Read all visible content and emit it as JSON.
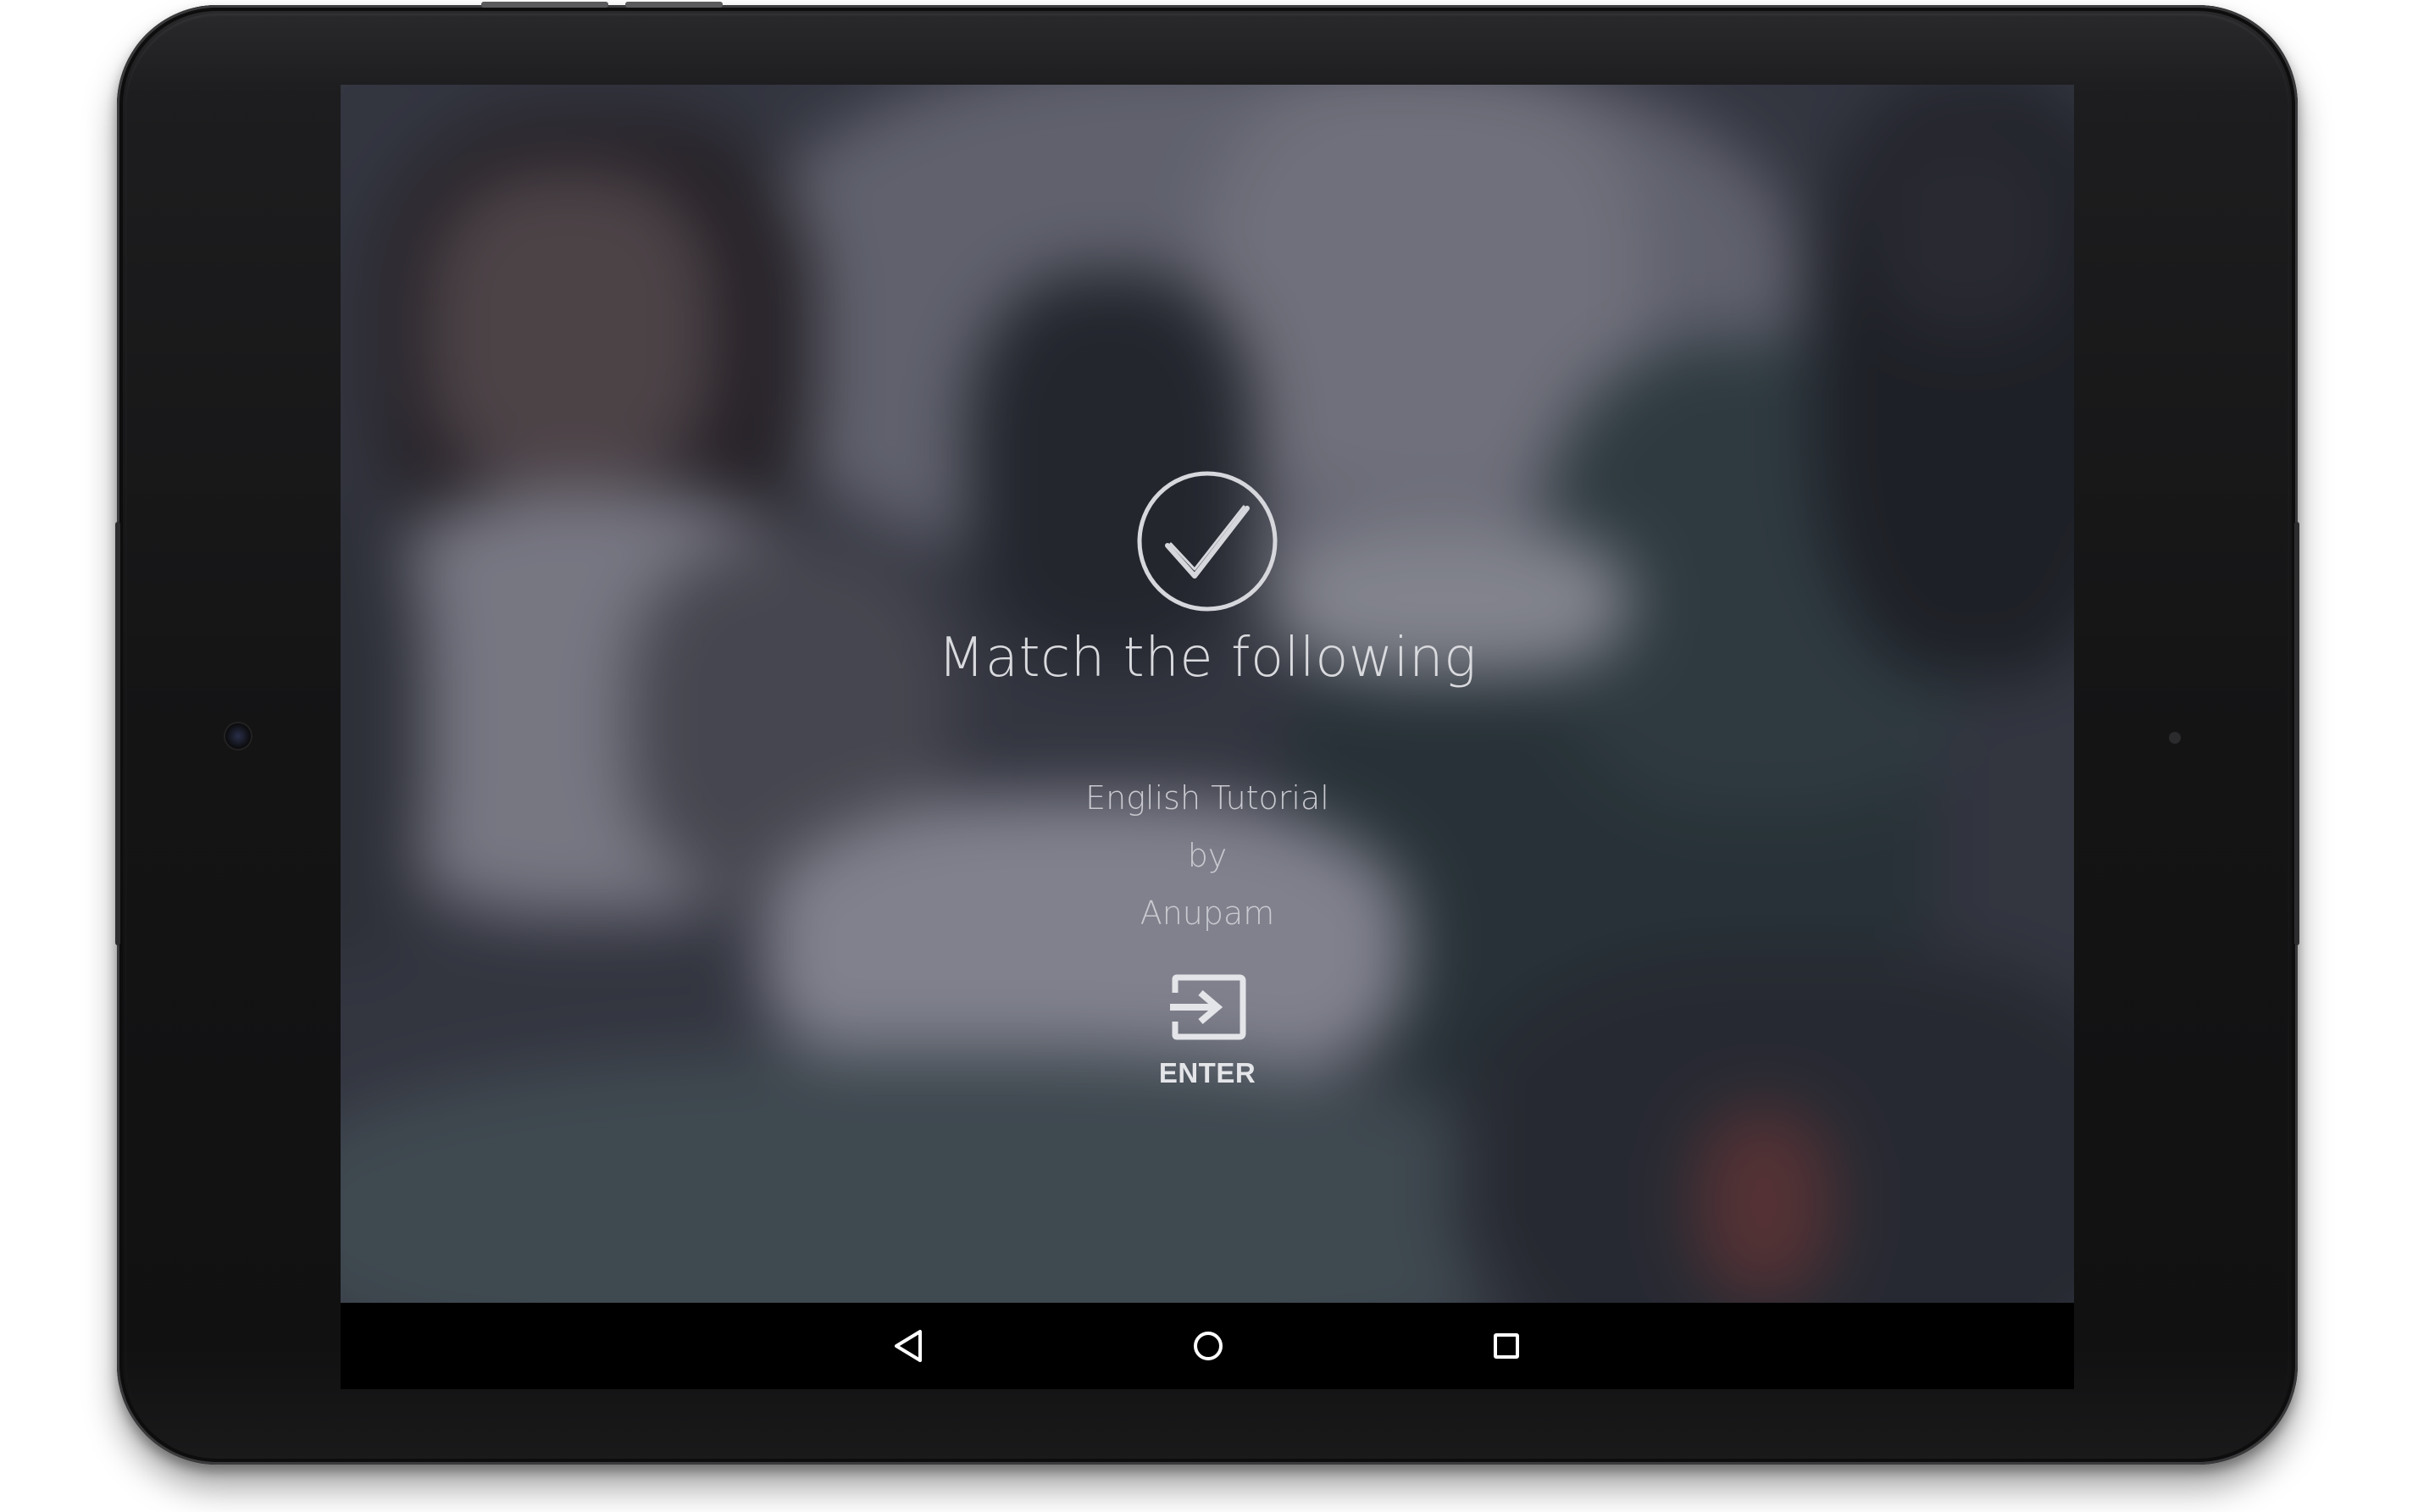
{
  "screen": {
    "title": "Match the following",
    "subtitle_lines": [
      "English Tutorial",
      "by",
      "Anupam"
    ],
    "enter_button": {
      "label": "ENTER",
      "icon": "enter-icon"
    },
    "header_icon": "check-circle-icon"
  },
  "navigation_bar": {
    "back_icon": "back-triangle-icon",
    "home_icon": "home-circle-icon",
    "recents_icon": "recents-square-icon"
  },
  "colors": {
    "text": "#d9dade",
    "icon": "#d6d7dc",
    "navbar": "#000000",
    "device_frame": "#141415"
  }
}
